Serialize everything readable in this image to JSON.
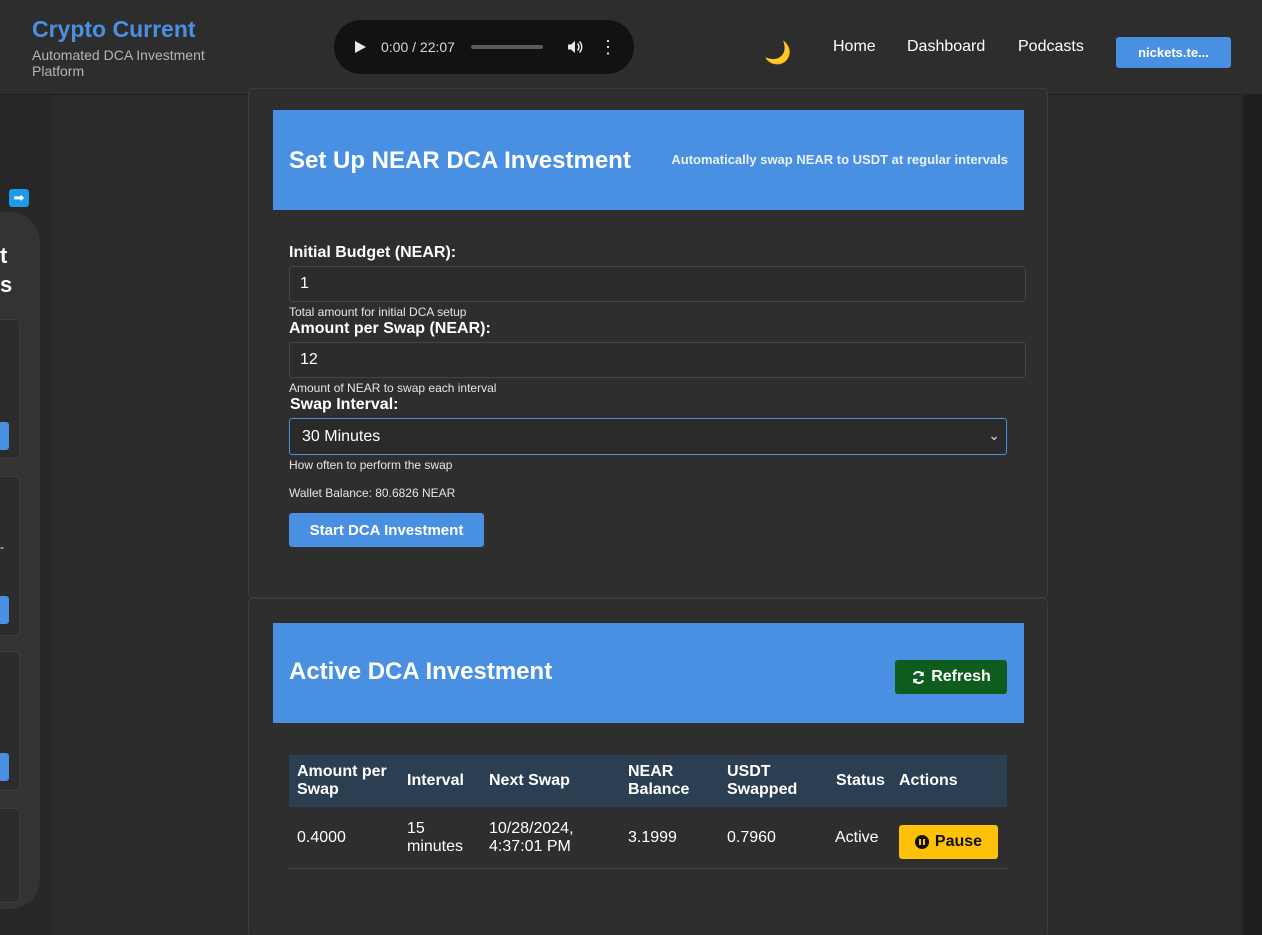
{
  "header": {
    "brand_title": "Crypto Current",
    "brand_subtitle": "Automated DCA Investment Platform",
    "audio": {
      "time": "0:00 / 22:07"
    },
    "theme_icon": "moon-icon",
    "nav": {
      "home": "Home",
      "dashboard": "Dashboard",
      "podcasts": "Podcasts"
    },
    "wallet_button": "nickets.te..."
  },
  "sidebar": {
    "toggle_icon": "arrow-right-icon",
    "partial_text_1": "t",
    "partial_text_2": "s",
    "partial_text_3": "-"
  },
  "setup": {
    "title": "Set Up NEAR DCA Investment",
    "subtitle": "Automatically swap NEAR to USDT at regular intervals",
    "initial_budget": {
      "label": "Initial Budget (NEAR):",
      "value": "1",
      "hint": "Total amount for initial DCA setup"
    },
    "amount_per_swap": {
      "label": "Amount per Swap (NEAR):",
      "value": "12",
      "hint": "Amount of NEAR to swap each interval"
    },
    "swap_interval": {
      "label": "Swap Interval:",
      "selected": "30 Minutes",
      "hint": "How often to perform the swap"
    },
    "wallet_balance": "Wallet Balance: 80.6826 NEAR",
    "start_button": "Start DCA Investment"
  },
  "active": {
    "title": "Active DCA Investment",
    "refresh_button": "Refresh",
    "columns": [
      "Amount per Swap",
      "Interval",
      "Next Swap",
      "NEAR Balance",
      "USDT Swapped",
      "Status",
      "Actions"
    ],
    "rows": [
      {
        "amount": "0.4000",
        "interval": "15 minutes",
        "next_swap": "10/28/2024, 4:37:01 PM",
        "near_balance": "3.1999",
        "usdt_swapped": "0.7960",
        "status": "Active",
        "action": "Pause"
      }
    ]
  },
  "colors": {
    "accent": "#4a90e2",
    "refresh": "#0f5c1f",
    "pause": "#ffc107",
    "table_header": "#2c3e52"
  }
}
